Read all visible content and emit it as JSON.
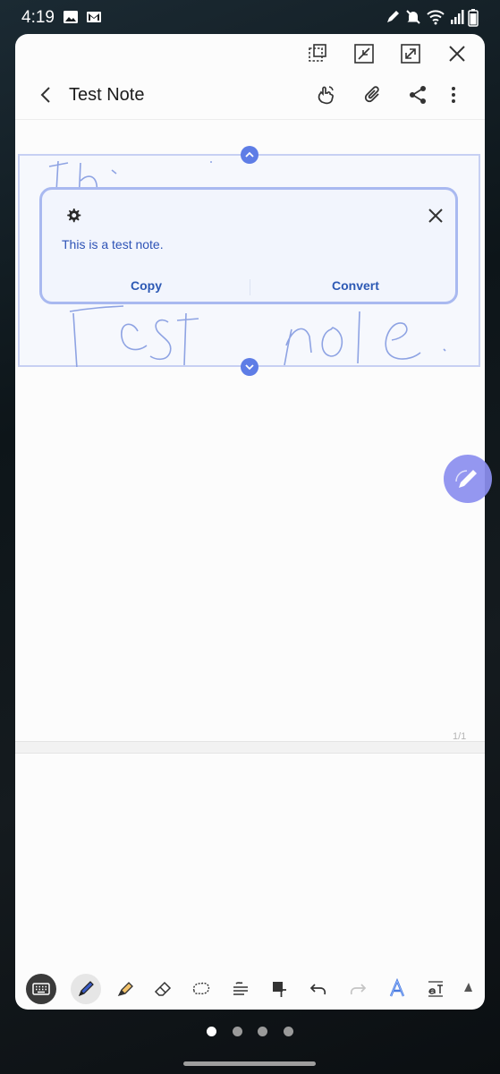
{
  "status_bar": {
    "time": "4:19",
    "left_icons": [
      "gallery-icon",
      "gmail-icon"
    ],
    "right_icons": [
      "pen-icon",
      "mute-icon",
      "wifi-icon",
      "signal-icon",
      "battery-icon"
    ]
  },
  "window_controls": [
    "window-resize-icon",
    "minimize-icon",
    "maximize-icon",
    "close-icon"
  ],
  "header": {
    "title": "Test Note",
    "actions": [
      "hand-touch-icon",
      "attach-icon",
      "share-icon",
      "more-icon"
    ]
  },
  "handwriting": {
    "top_line": "Th",
    "bottom_line": "Test note"
  },
  "popup": {
    "message": "This is a test note.",
    "copy_label": "Copy",
    "convert_label": "Convert"
  },
  "page_indicator": "1/1",
  "toolbar": {
    "tools": [
      "keyboard-icon",
      "pen-icon",
      "highlighter-icon",
      "eraser-icon",
      "lasso-icon",
      "straighten-icon",
      "text-box-icon",
      "undo-icon",
      "redo-icon",
      "style-icon",
      "text-format-icon",
      "more-tools-icon"
    ],
    "selected_tool": "pen-icon"
  },
  "page_dots": {
    "count": 4,
    "active": 0
  },
  "colors": {
    "accent": "#5e7de6",
    "popup_text": "#2e53b6",
    "handwriting": "#8ea3e3",
    "fab": "#8c8ff0"
  }
}
